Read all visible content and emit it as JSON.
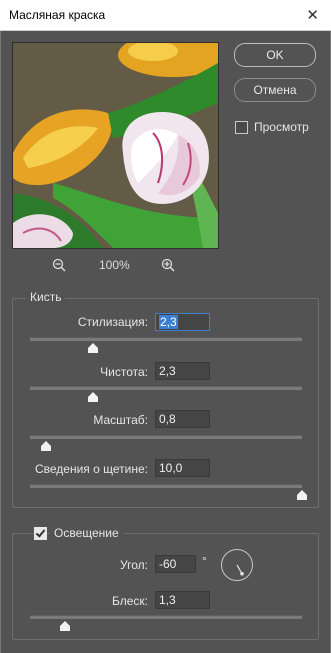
{
  "window": {
    "title": "Масляная краска",
    "close_glyph": "✕"
  },
  "preview": {
    "zoom_out_icon": "zoom-out-icon",
    "zoom_level": "100%",
    "zoom_in_icon": "zoom-in-icon"
  },
  "buttons": {
    "ok": "OK",
    "cancel": "Отмена"
  },
  "preview_toggle": {
    "label": "Просмотр",
    "checked": false
  },
  "brush": {
    "title": "Кисть",
    "stylization": {
      "label": "Стилизация:",
      "value": "2,3",
      "level": 0.23
    },
    "cleanliness": {
      "label": "Чистота:",
      "value": "2,3",
      "level": 0.23
    },
    "scale": {
      "label": "Масштаб:",
      "value": "0,8",
      "level": 0.06
    },
    "bristle_detail": {
      "label": "Сведения о щетине:",
      "value": "10,0",
      "level": 1.0
    }
  },
  "lighting": {
    "title": "Освещение",
    "enabled": true,
    "angle": {
      "label": "Угол:",
      "value": "-60",
      "unit": "°"
    },
    "shine": {
      "label": "Блеск:",
      "value": "1,3",
      "level": 0.13
    }
  },
  "colors": {
    "bg": "#535353",
    "accent": "#3a7fd0"
  }
}
